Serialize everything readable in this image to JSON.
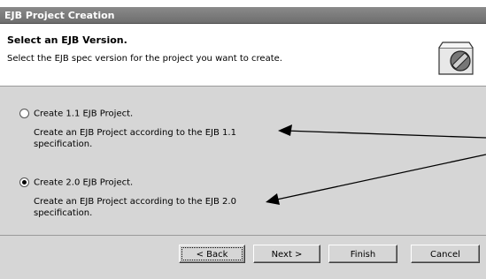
{
  "window": {
    "title": "EJB Project Creation"
  },
  "header": {
    "title": "Select an EJB Version.",
    "description": "Select the EJB spec version for the project you want to create."
  },
  "options": [
    {
      "label": "Create 1.1 EJB Project.",
      "description": "Create an EJB Project according to the EJB 1.1 specification.",
      "selected": false
    },
    {
      "label": "Create 2.0 EJB Project.",
      "description": "Create an EJB Project according to the EJB 2.0 specification.",
      "selected": true
    }
  ],
  "buttons": {
    "back": "< Back",
    "next": "Next >",
    "finish": "Finish",
    "cancel": "Cancel"
  }
}
